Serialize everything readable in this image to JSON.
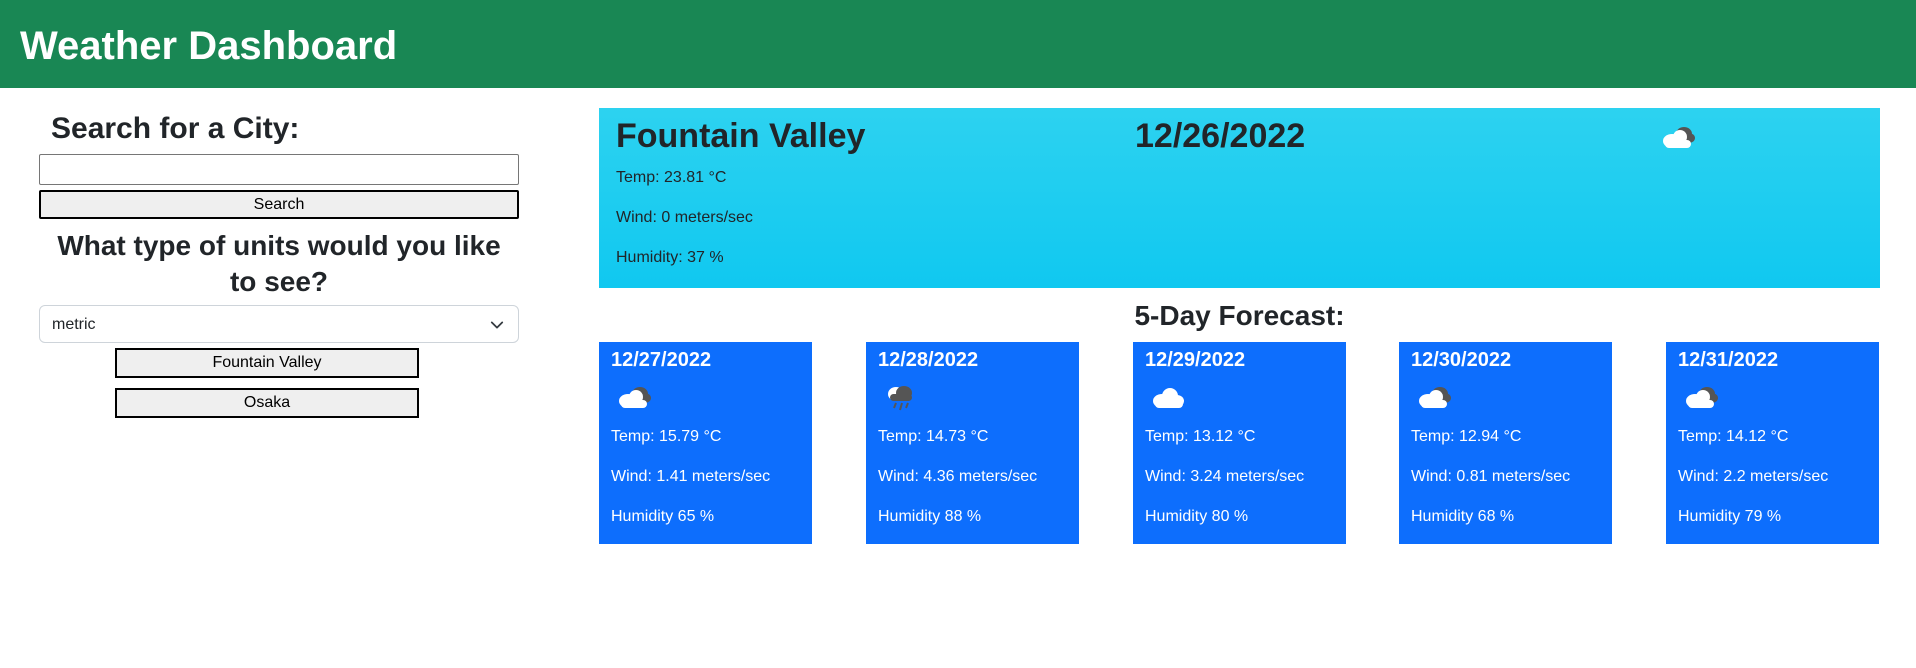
{
  "header": {
    "title": "Weather Dashboard"
  },
  "sidebar": {
    "search_title": "Search for a City:",
    "search_input_value": "",
    "search_button": "Search",
    "units_title": "What type of units would you like to see?",
    "units_selected": "metric",
    "history": [
      "Fountain Valley",
      "Osaka"
    ]
  },
  "current": {
    "city": "Fountain Valley",
    "date": "12/26/2022",
    "icon": "partly-cloudy-icon",
    "temp": "Temp: 23.81 °C",
    "wind": "Wind: 0 meters/sec",
    "humidity": "Humidity: 37 %"
  },
  "forecast": {
    "title": "5-Day Forecast:",
    "days": [
      {
        "date": "12/27/2022",
        "icon": "cloudy-icon",
        "temp": "Temp: 15.79 °C",
        "wind": "Wind: 1.41 meters/sec",
        "humidity": "Humidity 65 %"
      },
      {
        "date": "12/28/2022",
        "icon": "rain-cloud-icon",
        "temp": "Temp: 14.73 °C",
        "wind": "Wind: 4.36 meters/sec",
        "humidity": "Humidity 88 %"
      },
      {
        "date": "12/29/2022",
        "icon": "cloud-icon",
        "temp": "Temp: 13.12 °C",
        "wind": "Wind: 3.24 meters/sec",
        "humidity": "Humidity 80 %"
      },
      {
        "date": "12/30/2022",
        "icon": "cloudy-icon",
        "temp": "Temp: 12.94 °C",
        "wind": "Wind: 0.81 meters/sec",
        "humidity": "Humidity 68 %"
      },
      {
        "date": "12/31/2022",
        "icon": "cloudy-icon",
        "temp": "Temp: 14.12 °C",
        "wind": "Wind: 2.2 meters/sec",
        "humidity": "Humidity 79 %"
      }
    ]
  },
  "colors": {
    "header": "#198754",
    "current_bg": "#14cbf0",
    "forecast_card": "#0d6efd"
  }
}
